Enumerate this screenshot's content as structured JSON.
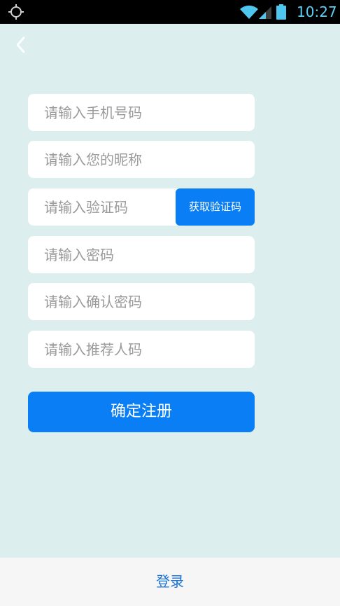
{
  "status_bar": {
    "time": "10:27",
    "icons": [
      "gps-icon",
      "wifi-icon",
      "signal-icon",
      "battery-icon"
    ],
    "time_color": "#5ad0f5"
  },
  "header": {
    "back_icon": "chevron-left-icon"
  },
  "form": {
    "phone_placeholder": "请输入手机号码",
    "nickname_placeholder": "请输入您的昵称",
    "code_placeholder": "请输入验证码",
    "get_code_label": "获取验证码",
    "password_placeholder": "请输入密码",
    "confirm_password_placeholder": "请输入确认密码",
    "referral_placeholder": "请输入推荐人码",
    "submit_label": "确定注册"
  },
  "footer": {
    "login_label": "登录"
  },
  "colors": {
    "background": "#ddeeee",
    "accent": "#0a7ff5",
    "link": "#1a73d9"
  }
}
